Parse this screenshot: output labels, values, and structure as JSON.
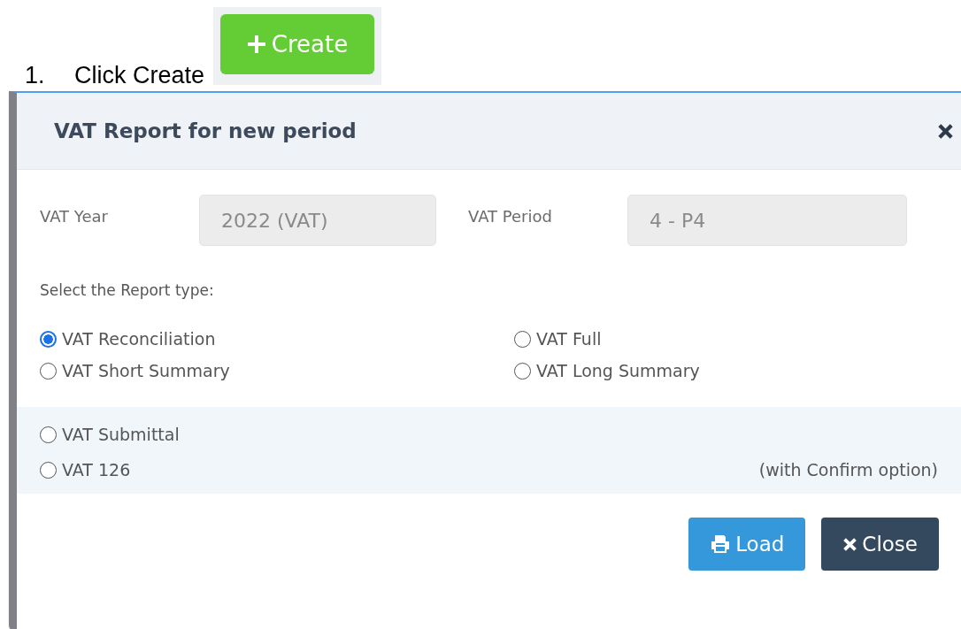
{
  "instruction": {
    "number": "1.",
    "text": "Click Create"
  },
  "create_button": {
    "label": "Create"
  },
  "dialog": {
    "title": "VAT Report for new period",
    "fields": [
      {
        "label": "VAT Year",
        "value": "2022 (VAT)"
      },
      {
        "label": "VAT Period",
        "value": "4 - P4"
      }
    ],
    "prompt": "Select the Report type:",
    "report_types": [
      {
        "label": "VAT Reconciliation",
        "selected": true
      },
      {
        "label": "VAT Full",
        "selected": false
      },
      {
        "label": "VAT Short Summary",
        "selected": false
      },
      {
        "label": "VAT Long Summary",
        "selected": false
      }
    ],
    "confirm_types": [
      {
        "label": "VAT Submittal",
        "selected": false
      },
      {
        "label": "VAT 126",
        "selected": false
      }
    ],
    "confirm_note": "(with Confirm option)",
    "buttons": [
      {
        "kind": "load",
        "label": "Load"
      },
      {
        "kind": "close",
        "label": "Close"
      }
    ]
  }
}
